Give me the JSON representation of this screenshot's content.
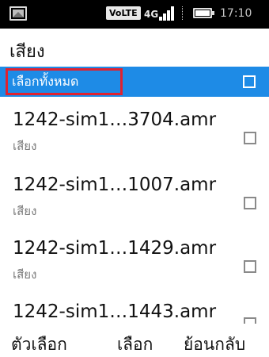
{
  "status_bar": {
    "icons": [
      "gallery-icon",
      "volte-icon",
      "signal-icon",
      "battery-icon"
    ],
    "volte": "VoLTE",
    "network": "4G",
    "time": "17:10"
  },
  "header": {
    "title": "เสียง"
  },
  "select_all": {
    "label": "เลือกทั้งหมด",
    "checked": false,
    "highlight_color": "#1e8be6",
    "annotation_color": "#e0222f"
  },
  "files": [
    {
      "name": "1242-sim1…3704.amr",
      "type": "เสียง",
      "checked": false
    },
    {
      "name": "1242-sim1…1007.amr",
      "type": "เสียง",
      "checked": false
    },
    {
      "name": "1242-sim1…1429.amr",
      "type": "เสียง",
      "checked": false
    },
    {
      "name": "1242-sim1…1443.amr",
      "type": "",
      "checked": false
    }
  ],
  "softkeys": {
    "left": "ตัวเลือก",
    "center": "เลือก",
    "right": "ย้อนกลับ"
  }
}
